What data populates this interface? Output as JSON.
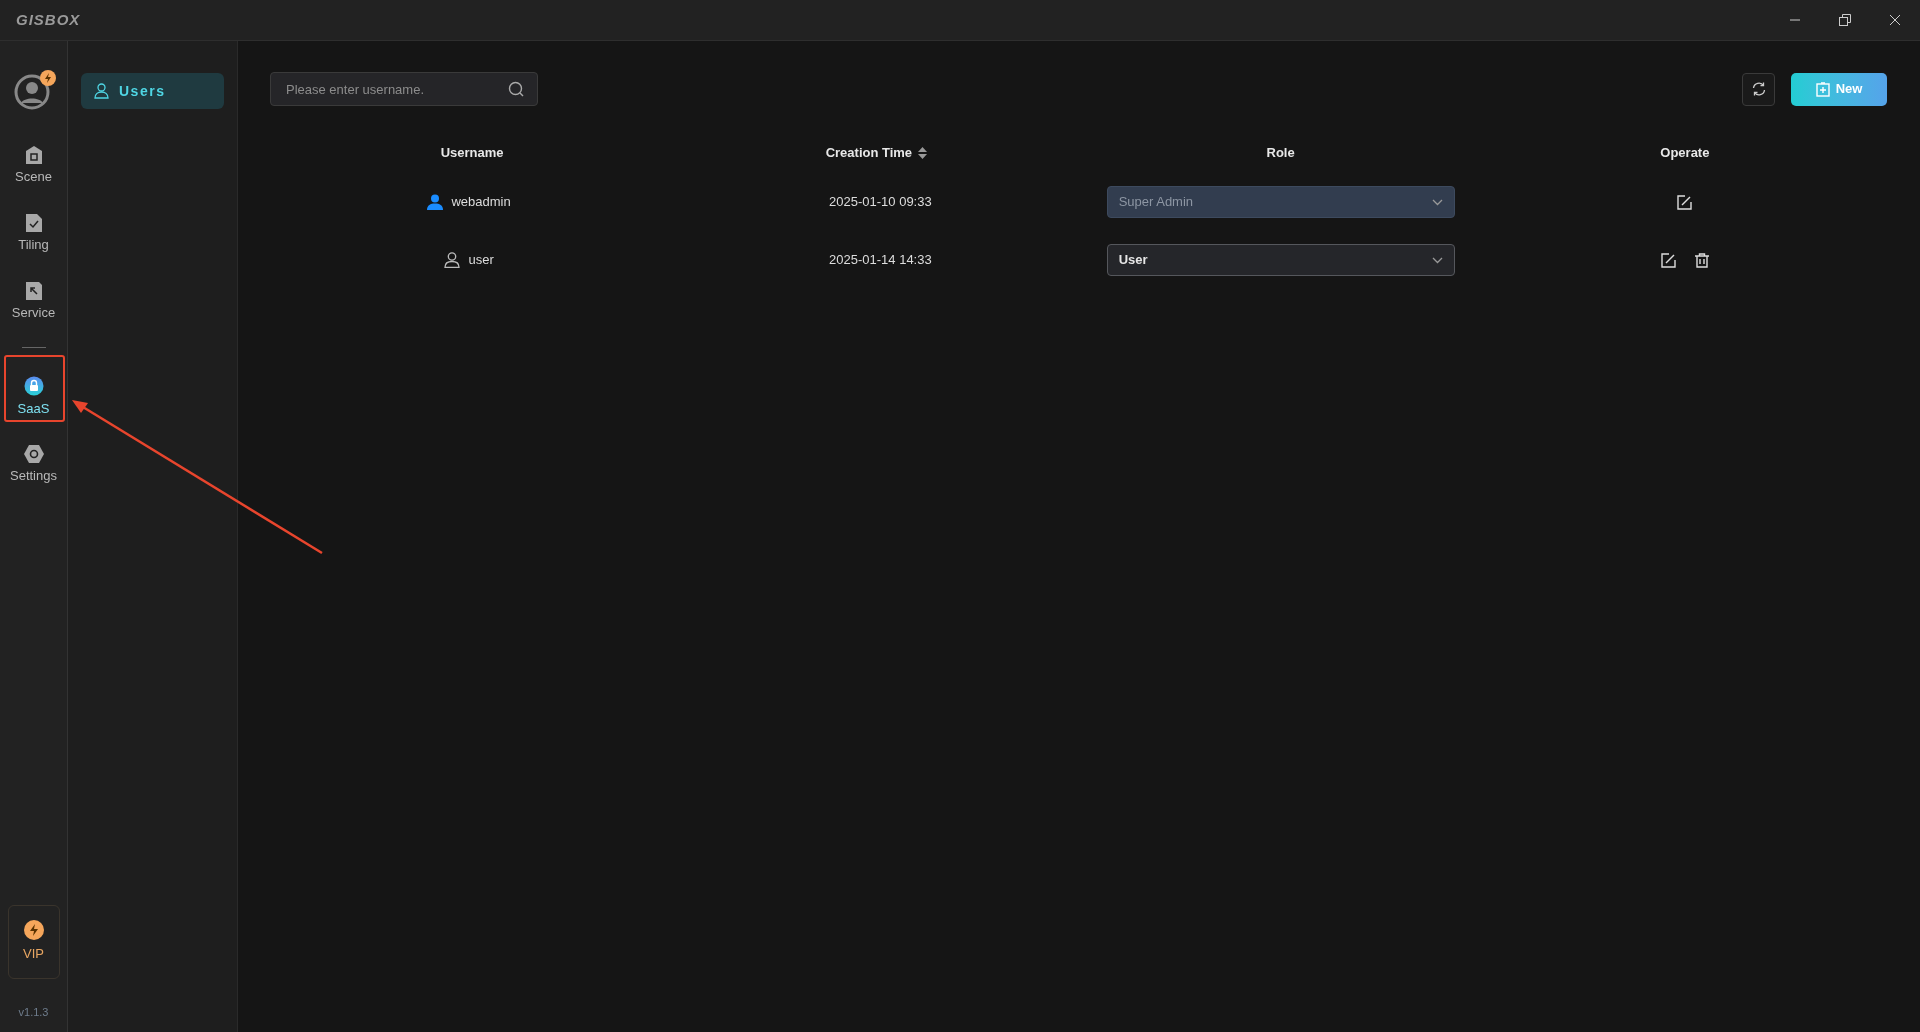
{
  "window": {
    "logo": "GISBOX"
  },
  "nav": [
    {
      "label": "Scene",
      "kind": "scene",
      "selected": false
    },
    {
      "label": "Tiling",
      "kind": "tiling",
      "selected": false
    },
    {
      "label": "Service",
      "kind": "service",
      "selected": false
    },
    {
      "kind": "divider"
    },
    {
      "label": "SaaS",
      "kind": "saas",
      "selected": true
    },
    {
      "label": "Settings",
      "kind": "settings",
      "selected": false
    }
  ],
  "vip": {
    "label": "VIP"
  },
  "version": "v1.1.3",
  "subnav": [
    {
      "label": "Users",
      "selected": true
    }
  ],
  "search": {
    "placeholder": "Please enter username."
  },
  "toolbar": {
    "new_label": "New"
  },
  "table": {
    "columns": [
      {
        "label": "Username",
        "sortable": false
      },
      {
        "label": "Creation Time",
        "sortable": true
      },
      {
        "label": "Role",
        "sortable": false
      },
      {
        "label": "Operate",
        "sortable": false
      }
    ],
    "rows": [
      {
        "username": "webadmin",
        "admin": true,
        "created": "2025-01-10 09:33",
        "role": "Super Admin",
        "role_disabled": true,
        "actions": [
          {
            "kind": "edit"
          }
        ]
      },
      {
        "username": "user",
        "admin": false,
        "created": "2025-01-14 14:33",
        "role": "User",
        "role_disabled": false,
        "actions": [
          {
            "kind": "edit"
          },
          {
            "kind": "delete"
          }
        ]
      }
    ]
  }
}
